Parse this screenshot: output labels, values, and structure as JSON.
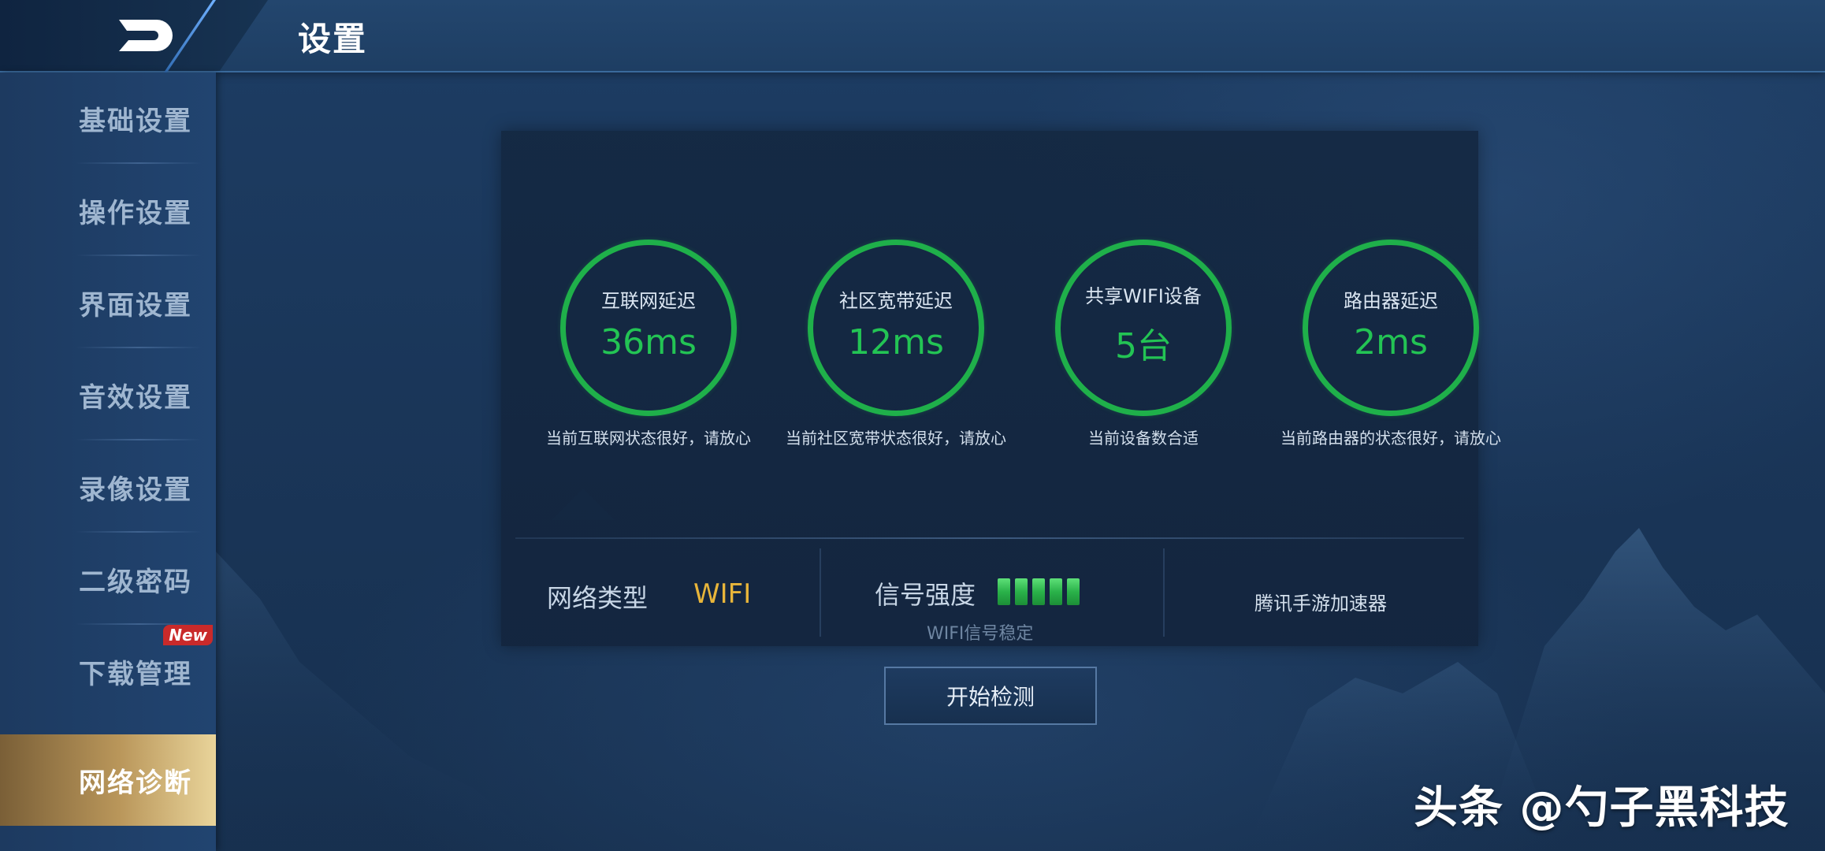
{
  "header": {
    "title": "设置"
  },
  "sidebar": {
    "items": [
      {
        "label": "基础设置"
      },
      {
        "label": "操作设置"
      },
      {
        "label": "界面设置"
      },
      {
        "label": "音效设置"
      },
      {
        "label": "录像设置"
      },
      {
        "label": "二级密码"
      },
      {
        "label": "下载管理",
        "badge": "New"
      },
      {
        "label": "网络诊断",
        "active": true
      }
    ]
  },
  "diagnosis": {
    "metrics": [
      {
        "label": "互联网延迟",
        "value": "36ms",
        "desc": "当前互联网状态很好，请放心"
      },
      {
        "label": "社区宽带延迟",
        "value": "12ms",
        "desc": "当前社区宽带状态很好，请放心"
      },
      {
        "label": "共享WIFI设备",
        "value": "5台",
        "desc": "当前设备数合适"
      },
      {
        "label": "路由器延迟",
        "value": "2ms",
        "desc": "当前路由器的状态很好，请放心"
      }
    ],
    "network_type_label": "网络类型",
    "network_type_value": "WIFI",
    "signal_label": "信号强度",
    "signal_bars": 5,
    "signal_note": "WIFI信号稳定",
    "accelerator": "腾讯手游加速器",
    "start_button": "开始检测"
  },
  "colors": {
    "ring": "#1fb04a",
    "value": "#23c454",
    "wifi": "#e8b53a",
    "active_tab": "#b9965a"
  },
  "watermark": "头条 @勺子黑科技"
}
